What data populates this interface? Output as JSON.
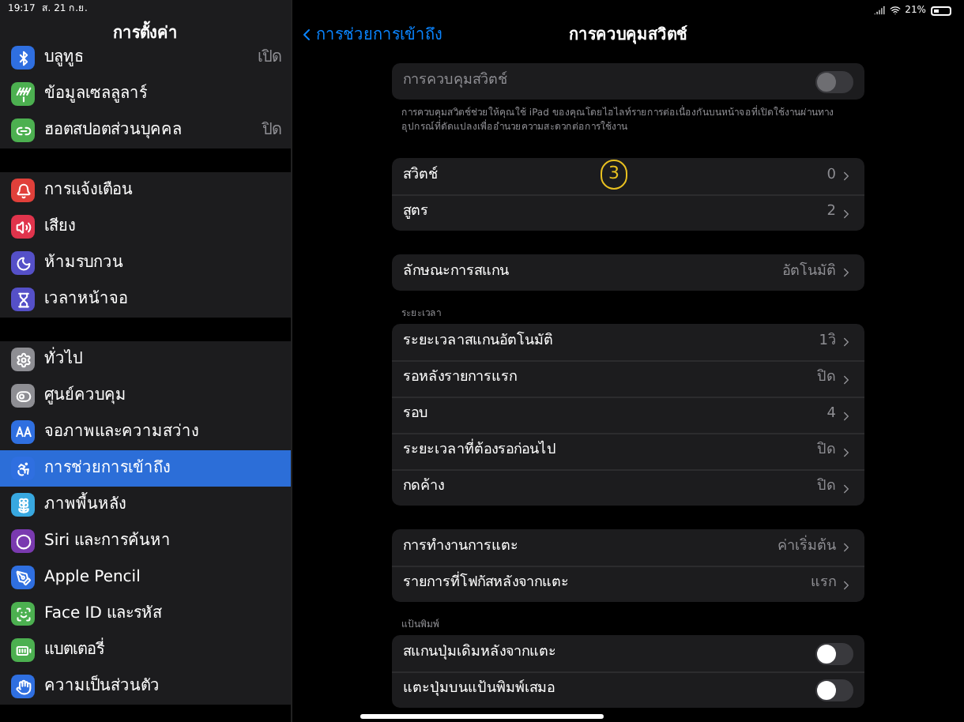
{
  "status_bar": {
    "time": "19:17",
    "date": "ส. 21 ก.ย.",
    "battery": "21%"
  },
  "sidebar": {
    "title": "การตั้งค่า",
    "groups": [
      [
        {
          "label": "บลูทูธ",
          "value": "เปิด",
          "kind": "bluetooth",
          "color": "#2f6fe0",
          "selected": false
        },
        {
          "label": "ข้อมูลเซลลูลาร์",
          "kind": "antenna",
          "color": "#4cb050",
          "selected": false
        },
        {
          "label": "ฮอตสปอตส่วนบุคคล",
          "value": "ปิด",
          "kind": "link",
          "color": "#4cb050",
          "selected": false
        }
      ],
      [
        {
          "label": "การแจ้งเตือน",
          "kind": "bell",
          "color": "#e0403a",
          "selected": false
        },
        {
          "label": "เสียง",
          "kind": "speaker",
          "color": "#e0344c",
          "selected": false
        },
        {
          "label": "ห้ามรบกวน",
          "kind": "moon",
          "color": "#5550c8",
          "selected": false
        },
        {
          "label": "เวลาหน้าจอ",
          "kind": "hourglass",
          "color": "#5550c8",
          "selected": false
        }
      ],
      [
        {
          "label": "ทั่วไป",
          "kind": "gear",
          "color": "#8e8e93",
          "selected": false
        },
        {
          "label": "ศูนย์ควบคุม",
          "kind": "toggles",
          "color": "#8e8e93",
          "selected": false
        },
        {
          "label": "จอภาพและความสว่าง",
          "kind": "aa",
          "color": "#2f6fe0",
          "selected": false
        },
        {
          "label": "การช่วยการเข้าถึง",
          "kind": "person",
          "color": "#2f6fe0",
          "selected": true
        },
        {
          "label": "ภาพพื้นหลัง",
          "kind": "flower",
          "color": "#38a8e0",
          "selected": false
        },
        {
          "label": "Siri และการค้นหา",
          "kind": "orb",
          "color": "#7a3ab0",
          "selected": false
        },
        {
          "label": "Apple Pencil",
          "kind": "pencil",
          "color": "#2f6fe0",
          "selected": false
        },
        {
          "label": "Face ID และรหัส",
          "kind": "face",
          "color": "#4cb050",
          "selected": false
        },
        {
          "label": "แบตเตอรี่",
          "kind": "battery",
          "color": "#4cb050",
          "selected": false
        },
        {
          "label": "ความเป็นส่วนตัว",
          "kind": "hand",
          "color": "#2f6fe0",
          "selected": false
        }
      ]
    ]
  },
  "detail": {
    "back": "การช่วยการเข้าถึง",
    "title": "การควบคุมสวิตช์",
    "annotation": "3",
    "sections": [
      {
        "rows": [
          {
            "kind": "toggle",
            "label": "การควบคุมสวิตช์",
            "on": false,
            "disabled": true
          }
        ],
        "footer": "การควบคุมสวิตช์ช่วยให้คุณใช้ iPad ของคุณโดยไฮไลท์รายการต่อเนื่องกันบนหน้าจอที่เปิดใช้งานผ่านทางอุปกรณ์ที่ดัดแปลงเพื่ออำนวยความสะดวกต่อการใช้งาน"
      },
      {
        "rows": [
          {
            "kind": "link",
            "label": "สวิตช์",
            "value": "0"
          },
          {
            "kind": "link",
            "label": "สูตร",
            "value": "2"
          }
        ]
      },
      {
        "rows": [
          {
            "kind": "link",
            "label": "ลักษณะการสแกน",
            "value": "อัตโนมัติ"
          }
        ]
      },
      {
        "header": "ระยะเวลา",
        "rows": [
          {
            "kind": "link",
            "label": "ระยะเวลาสแกนอัตโนมัติ",
            "value": "1วิ"
          },
          {
            "kind": "link",
            "label": "รอหลังรายการแรก",
            "value": "ปิด"
          },
          {
            "kind": "link",
            "label": "รอบ",
            "value": "4"
          },
          {
            "kind": "link",
            "label": "ระยะเวลาที่ต้องรอก่อนไป",
            "value": "ปิด"
          },
          {
            "kind": "link",
            "label": "กดค้าง",
            "value": "ปิด"
          }
        ]
      },
      {
        "rows": [
          {
            "kind": "link",
            "label": "การทำงานการแตะ",
            "value": "ค่าเริ่มต้น"
          },
          {
            "kind": "link",
            "label": "รายการที่โฟกัสหลังจากแตะ",
            "value": "แรก"
          }
        ]
      },
      {
        "header": "แป้นพิมพ์",
        "rows": [
          {
            "kind": "toggle",
            "label": "สแกนปุ่มเดิมหลังจากแตะ",
            "on": false,
            "disabled": false
          },
          {
            "kind": "toggle",
            "label": "แตะปุ่มบนแป้นพิมพ์เสมอ",
            "on": false,
            "disabled": false
          }
        ]
      }
    ]
  }
}
